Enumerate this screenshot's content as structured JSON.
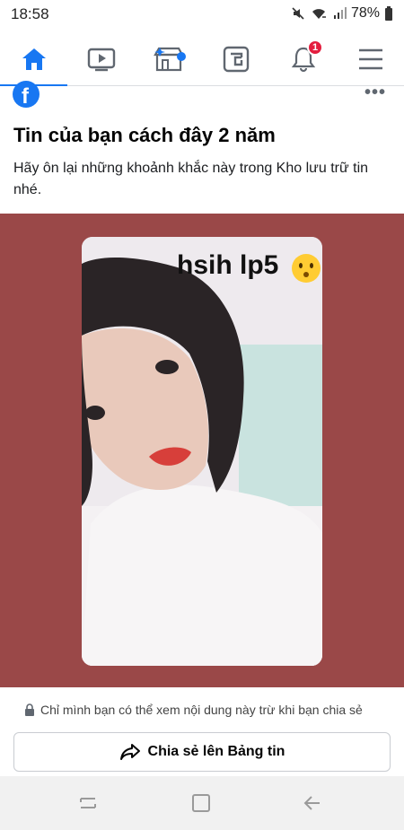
{
  "status_bar": {
    "time": "18:58",
    "battery": "78%",
    "icons": [
      "mute-icon",
      "wifi-icon",
      "signal-icon",
      "battery-icon"
    ]
  },
  "nav": {
    "items": [
      {
        "name": "home",
        "icon": "home-icon",
        "active": true
      },
      {
        "name": "watch",
        "icon": "video-icon",
        "active": false
      },
      {
        "name": "marketplace",
        "icon": "store-icon",
        "active": false
      },
      {
        "name": "gaming",
        "icon": "gaming-icon",
        "active": false
      },
      {
        "name": "notifications",
        "icon": "bell-icon",
        "active": false,
        "badge": "1"
      },
      {
        "name": "menu",
        "icon": "hamburger-icon",
        "active": false
      }
    ],
    "accent": "#1877f2",
    "badge_color": "#e41e3f"
  },
  "memory": {
    "title": "Tin của bạn cách đây 2 năm",
    "description": "Hãy ôn lại những khoảnh khắc này trong Kho lưu trữ tin nhé.",
    "more_label": "•••"
  },
  "story": {
    "background_color": "#9a4848",
    "overlay_text": "hsih lp5",
    "emoji": "hushed-face-emoji"
  },
  "privacy": {
    "text": "Chỉ mình bạn có thể xem nội dung này trừ khi bạn chia sẻ"
  },
  "share_button": {
    "label": "Chia sẻ lên Bảng tin"
  },
  "system_nav": {
    "buttons": [
      "recent-apps-icon",
      "home-button-icon",
      "back-icon"
    ]
  }
}
